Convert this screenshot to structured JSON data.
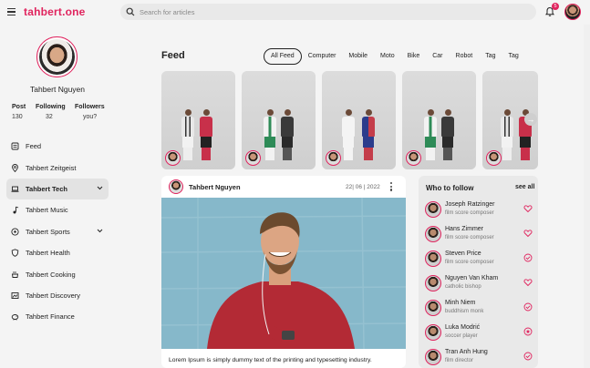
{
  "app": {
    "logo": "tahbert.one"
  },
  "search": {
    "placeholder": "Search for articles"
  },
  "notifications": {
    "count": "5"
  },
  "profile": {
    "name": "Tahbert Nguyen",
    "stats": [
      {
        "label": "Post",
        "value": "130"
      },
      {
        "label": "Following",
        "value": "32"
      },
      {
        "label": "Followers",
        "value": "you?"
      }
    ]
  },
  "sidebar": {
    "items": [
      {
        "label": "Feed",
        "icon": "feed-icon"
      },
      {
        "label": "Tahbert Zeitgeist",
        "icon": "location-pin-icon"
      },
      {
        "label": "Tahbert Tech",
        "icon": "laptop-icon",
        "active": true,
        "expandable": true
      },
      {
        "label": "Tahbert Music",
        "icon": "music-note-icon"
      },
      {
        "label": "Tahbert Sports",
        "icon": "football-icon",
        "expandable": true
      },
      {
        "label": "Tahbert Health",
        "icon": "shield-heart-icon"
      },
      {
        "label": "Tahbert Cooking",
        "icon": "cooking-icon"
      },
      {
        "label": "Tahbert Discovery",
        "icon": "discovery-icon"
      },
      {
        "label": "Tahbert Finance",
        "icon": "piggy-bank-icon"
      }
    ]
  },
  "feed": {
    "title": "Feed",
    "tabs": [
      "All Feed",
      "Computer",
      "Mobile",
      "Moto",
      "Bike",
      "Car",
      "Robot",
      "Tag",
      "Tag"
    ]
  },
  "post": {
    "author": "Tahbert Nguyen",
    "date": "22| 06 | 2022",
    "text": "Lorem Ipsum is simply dummy text of the printing and typesetting industry."
  },
  "who_to_follow": {
    "title": "Who to follow",
    "see_all": "see all",
    "people": [
      {
        "name": "Joseph Ratzinger",
        "role": "film score composer",
        "action": "heart-icon"
      },
      {
        "name": "Hans Zimmer",
        "role": "film score composer",
        "action": "heart-icon"
      },
      {
        "name": "Steven Price",
        "role": "film score composer",
        "action": "verified-icon"
      },
      {
        "name": "Nguyen Van Kham",
        "role": "catholic bishop",
        "action": "heart-icon"
      },
      {
        "name": "Minh Niem",
        "role": "buddhism monk",
        "action": "verified-icon"
      },
      {
        "name": "Luka Modrić",
        "role": "soccer player",
        "action": "star-badge-icon"
      },
      {
        "name": "Tran Anh Hung",
        "role": "film director",
        "action": "verified-icon"
      }
    ]
  },
  "colors": {
    "accent": "#e0245e",
    "background": "#f4f4f4",
    "card": "#ffffff",
    "panel": "#e9e9e9"
  }
}
